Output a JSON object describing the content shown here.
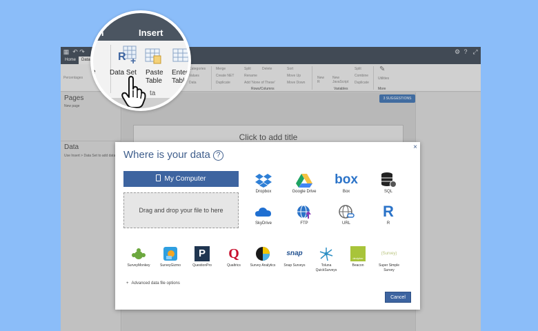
{
  "window": {
    "tabs": [
      "Home",
      "Data"
    ],
    "ribbon": {
      "left_items": [
        "Percentages",
        "e"
      ],
      "col1": [
        "Categories",
        "Values",
        "Data"
      ],
      "col2": [
        "Merge",
        "Create NET",
        "Duplicate"
      ],
      "col3": [
        "Split",
        "Rename",
        "Add 'None of These'"
      ],
      "col4": [
        "Delete",
        "Move Up",
        "Move Down"
      ],
      "col5": [
        "Sort",
        "Move Up",
        "Move Down"
      ],
      "group_rows_columns": "Rows/Columns",
      "new_r": "New R",
      "new_js": "New JavaScript",
      "col6": [
        "Split",
        "Combine",
        "Duplicate"
      ],
      "group_variables": "Variables",
      "utilities": "Utilities",
      "more": "More"
    }
  },
  "sidebar": {
    "pages_title": "Pages",
    "new_page": "New page",
    "data_title": "Data",
    "data_hint": "Use Insert > Data Set to add data"
  },
  "canvas": {
    "slide_title": "Click to add title",
    "suggestions": "SUGGESTIONS",
    "suggestions_count": "3"
  },
  "magnifier": {
    "tabs": [
      "ion",
      "Insert"
    ],
    "buttons": [
      "e",
      "Data Set",
      "Paste Table",
      "Enter Table"
    ],
    "group_label": "ta"
  },
  "dialog": {
    "title": "Where is your data",
    "help": "?",
    "close": "×",
    "my_computer": "My Computer",
    "drop_zone": "Drag and drop your file to here",
    "sources": [
      {
        "label": "Dropbox",
        "icon": "dropbox-icon"
      },
      {
        "label": "Google Drive",
        "icon": "google-drive-icon"
      },
      {
        "label": "Box",
        "icon": "box-icon",
        "logo": "box"
      },
      {
        "label": "SQL",
        "icon": "sql-icon"
      },
      {
        "label": "SkyDrive",
        "icon": "skydrive-icon"
      },
      {
        "label": "FTP",
        "icon": "ftp-icon"
      },
      {
        "label": "URL",
        "icon": "url-icon"
      },
      {
        "label": "R",
        "icon": "r-icon",
        "logo": "R"
      }
    ],
    "services": [
      {
        "label": "SurveyMonkey",
        "icon": "surveymonkey-icon"
      },
      {
        "label": "SurveyGizmo",
        "icon": "surveygizmo-icon"
      },
      {
        "label": "QuestionPro",
        "icon": "questionpro-icon",
        "logo": "P"
      },
      {
        "label": "Qualtrics",
        "icon": "qualtrics-icon",
        "logo": "Q"
      },
      {
        "label": "Survey Analytics",
        "icon": "survey-analytics-icon"
      },
      {
        "label": "Snap Surveys",
        "icon": "snap-surveys-icon",
        "logo": "snap"
      },
      {
        "label": "Toluna QuickSurveys",
        "icon": "toluna-icon"
      },
      {
        "label": "Beacon",
        "icon": "beacon-icon",
        "logo": "decipher"
      },
      {
        "label": "Super Simple Survey",
        "icon": "super-simple-survey-icon",
        "logo": "(Survey)"
      }
    ],
    "advanced": "Advanced data file options",
    "advanced_prefix": "+",
    "cancel": "Cancel"
  },
  "colors": {
    "background": "#8bbdf9",
    "accent": "#3d64a0",
    "title_blue": "#3f5e8c",
    "titlebar": "#4b5561"
  }
}
